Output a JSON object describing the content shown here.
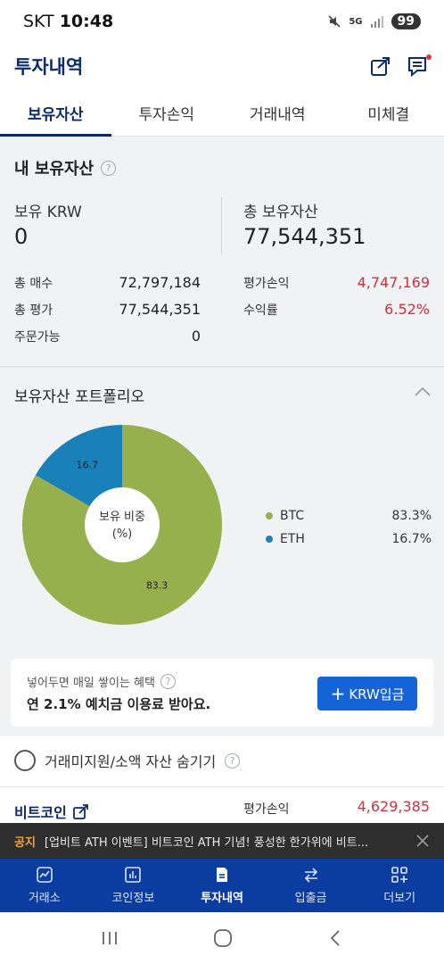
{
  "status_bar": {
    "carrier": "SKT",
    "time": "10:48",
    "network": "5G",
    "battery": "99"
  },
  "header": {
    "title": "투자내역"
  },
  "tabs": [
    {
      "label": "보유자산",
      "active": true
    },
    {
      "label": "투자손익",
      "active": false
    },
    {
      "label": "거래내역",
      "active": false
    },
    {
      "label": "미체결",
      "active": false
    }
  ],
  "summary": {
    "title": "내 보유자산",
    "krw_label": "보유 KRW",
    "krw_value": "0",
    "total_label": "총 보유자산",
    "total_value": "77,544,351",
    "rows_left": [
      {
        "label": "총 매수",
        "value": "72,797,184"
      },
      {
        "label": "총 평가",
        "value": "77,544,351"
      },
      {
        "label": "주문가능",
        "value": "0"
      }
    ],
    "rows_right": [
      {
        "label": "평가손익",
        "value": "4,747,169"
      },
      {
        "label": "수익률",
        "value": "6.52%"
      }
    ]
  },
  "portfolio": {
    "title": "보유자산 포트폴리오",
    "center_line1": "보유 비중",
    "center_line2": "(%)",
    "slice_labels": [
      "83.3",
      "16.7"
    ],
    "legend": [
      {
        "name": "BTC",
        "pct": "83.3%",
        "color": "#97b04e"
      },
      {
        "name": "ETH",
        "pct": "16.7%",
        "color": "#1a80b8"
      }
    ]
  },
  "chart_data": {
    "type": "pie",
    "categories": [
      "BTC",
      "ETH"
    ],
    "values": [
      83.3,
      16.7
    ],
    "colors": [
      "#97b04e",
      "#1a80b8"
    ],
    "title": "보유 비중 (%)"
  },
  "promo": {
    "subtitle": "넣어두면 매일 쌓이는 혜택",
    "main": "연 2.1% 예치금 이용료 받아요.",
    "button_label": "KRW입금"
  },
  "hide_toggle": {
    "label": "거래미지원/소액 자산 숨기기"
  },
  "coin_row": {
    "name": "비트코인",
    "label": "평가손익",
    "value": "4,629,385"
  },
  "notice": {
    "tag": "공지",
    "text": "[업비트 ATH 이벤트] 비트코인 ATH 기념! 풍성한 한가위에 비트..."
  },
  "bottom_nav": [
    {
      "label": "거래소",
      "icon": "exchange-chart-icon",
      "active": false
    },
    {
      "label": "코인정보",
      "icon": "bar-chart-icon",
      "active": false
    },
    {
      "label": "투자내역",
      "icon": "document-icon",
      "active": true
    },
    {
      "label": "입출금",
      "icon": "transfer-arrows-icon",
      "active": false
    },
    {
      "label": "더보기",
      "icon": "grid-plus-icon",
      "active": false
    }
  ],
  "colors": {
    "brand": "#0d2b6b",
    "nav_bg": "#0b3da1",
    "positive": "#d32f3c",
    "button": "#1464d8"
  }
}
